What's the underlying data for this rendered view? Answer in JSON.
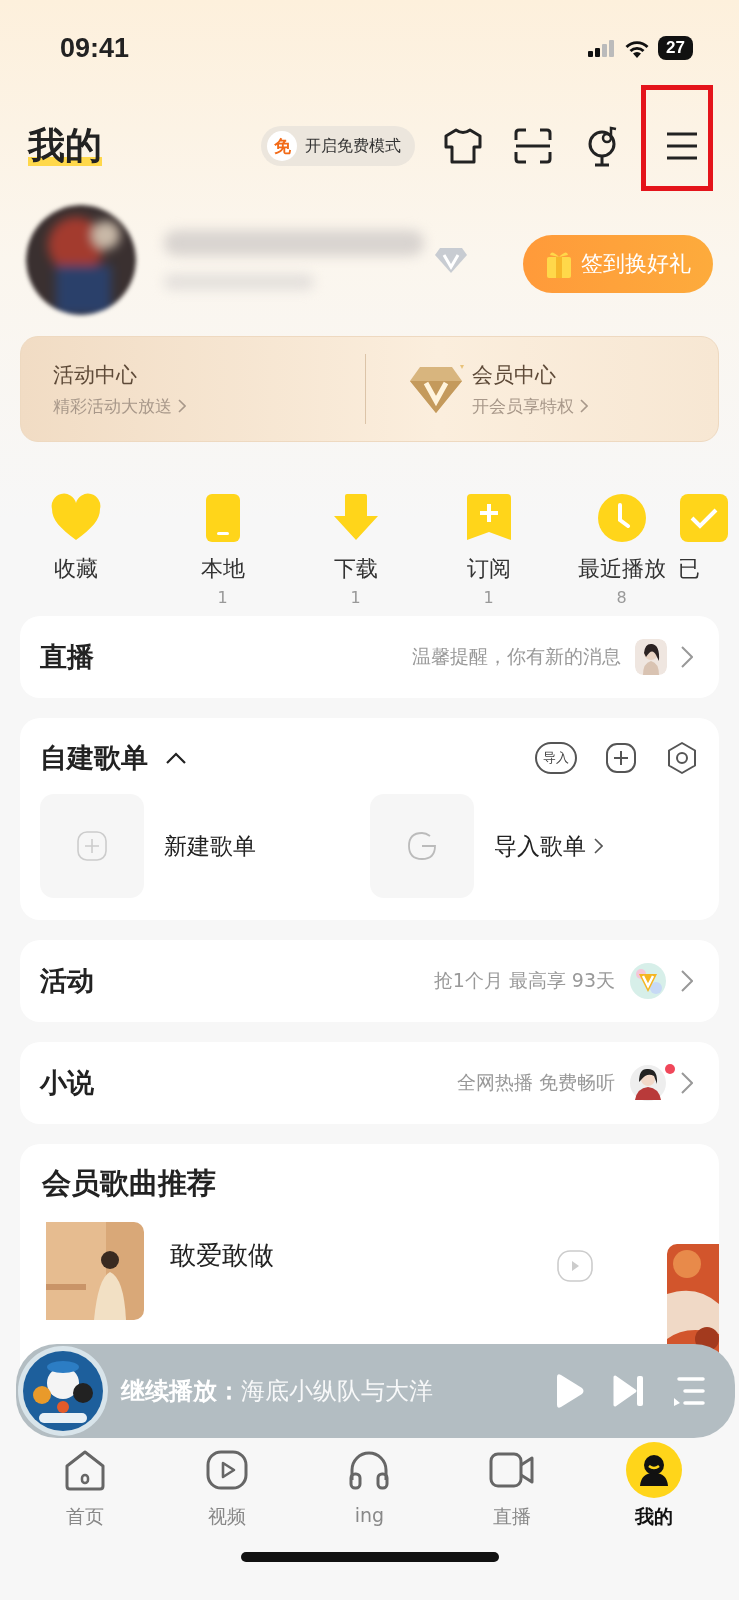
{
  "status_bar": {
    "time": "09:41",
    "battery": "27"
  },
  "header": {
    "title": "我的",
    "free_badge": "免",
    "free_mode": "开启免费模式",
    "highlight_menu": true
  },
  "profile": {
    "checkin": "签到换好礼"
  },
  "promo": [
    {
      "kind": "activity",
      "title": "活动中心",
      "subtitle": "精彩活动大放送"
    },
    {
      "kind": "vip",
      "title": "会员中心",
      "subtitle": "开会员享特权"
    }
  ],
  "shortcuts": [
    {
      "kind": "heart",
      "label": "收藏"
    },
    {
      "kind": "phone",
      "label": "本地",
      "count": "1"
    },
    {
      "kind": "download",
      "label": "下载",
      "count": "1"
    },
    {
      "kind": "bookmark",
      "label": "订阅",
      "count": "1"
    },
    {
      "kind": "clock",
      "label": "最近播放",
      "count": "8"
    },
    {
      "kind": "check",
      "label": "已"
    }
  ],
  "live": {
    "title": "直播",
    "note": "温馨提醒，你有新的消息"
  },
  "playlists": {
    "title": "自建歌单",
    "expanded": true,
    "import_badge": "导入",
    "items": [
      {
        "kind": "new",
        "label": "新建歌单"
      },
      {
        "kind": "import",
        "label": "导入歌单"
      }
    ]
  },
  "activity": {
    "title": "活动",
    "note": "抢1个月 最高享 93天"
  },
  "novel": {
    "title": "小说",
    "note": "全网热播 免费畅听",
    "unread": true
  },
  "recommend": {
    "title": "会员歌曲推荐",
    "songs": [
      {
        "title": "敢爱敢做"
      }
    ]
  },
  "player": {
    "label": "继续播放：",
    "track": "海底小纵队与大洋"
  },
  "tabs": [
    {
      "kind": "home",
      "label": "首页",
      "selected": false
    },
    {
      "kind": "video",
      "label": "视频",
      "selected": false
    },
    {
      "kind": "headphones",
      "label": "ing",
      "selected": false
    },
    {
      "kind": "camera",
      "label": "直播",
      "selected": false
    },
    {
      "kind": "me",
      "label": "我的",
      "selected": true
    }
  ]
}
